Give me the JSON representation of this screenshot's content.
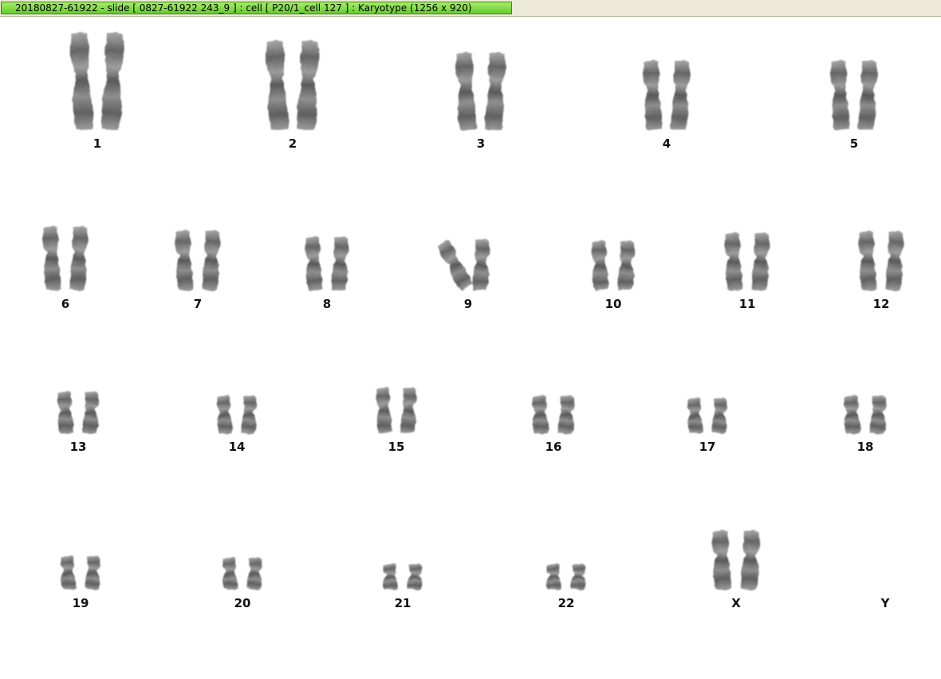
{
  "window": {
    "title": "20180827-61922 - slide [ 0827-61922 243_9 ] : cell [ P20/1_cell 127 ] : Karyotype  (1256 x 920)"
  },
  "karyotype": {
    "rows": [
      {
        "labels": [
          "1",
          "2",
          "3",
          "4",
          "5"
        ]
      },
      {
        "labels": [
          "6",
          "7",
          "8",
          "9",
          "10",
          "11",
          "12"
        ]
      },
      {
        "labels": [
          "13",
          "14",
          "15",
          "16",
          "17",
          "18"
        ]
      },
      {
        "labels": [
          "19",
          "20",
          "21",
          "22",
          "X",
          "Y"
        ]
      }
    ]
  }
}
